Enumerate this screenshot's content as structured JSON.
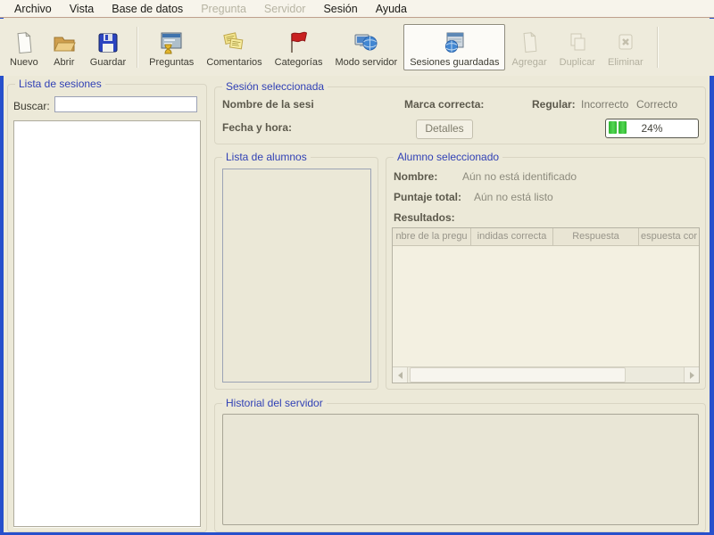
{
  "menubar": {
    "items": [
      {
        "label": "Archivo",
        "enabled": true
      },
      {
        "label": "Vista",
        "enabled": true
      },
      {
        "label": "Base de datos",
        "enabled": true
      },
      {
        "label": "Pregunta",
        "enabled": false
      },
      {
        "label": "Servidor",
        "enabled": false
      },
      {
        "label": "Sesión",
        "enabled": true
      },
      {
        "label": "Ayuda",
        "enabled": true
      }
    ]
  },
  "toolbar": {
    "overflow_chevron": "»",
    "buttons": [
      {
        "label": "Nuevo",
        "icon": "new-document-icon",
        "enabled": true,
        "selected": false
      },
      {
        "label": "Abrir",
        "icon": "open-folder-icon",
        "enabled": true,
        "selected": false
      },
      {
        "label": "Guardar",
        "icon": "save-floppy-icon",
        "enabled": true,
        "selected": false
      },
      {
        "label": "Preguntas",
        "icon": "questions-icon",
        "enabled": true,
        "selected": false
      },
      {
        "label": "Comentarios",
        "icon": "comments-notes-icon",
        "enabled": true,
        "selected": false
      },
      {
        "label": "Categorías",
        "icon": "categories-flag-icon",
        "enabled": true,
        "selected": false
      },
      {
        "label": "Modo servidor",
        "icon": "server-mode-icon",
        "enabled": true,
        "selected": false
      },
      {
        "label": "Sesiones guardadas",
        "icon": "saved-sessions-icon",
        "enabled": true,
        "selected": true
      },
      {
        "label": "Agregar",
        "icon": "add-icon",
        "enabled": false,
        "selected": false
      },
      {
        "label": "Duplicar",
        "icon": "duplicate-icon",
        "enabled": false,
        "selected": false
      },
      {
        "label": "Eliminar",
        "icon": "delete-icon",
        "enabled": false,
        "selected": false
      }
    ]
  },
  "sessions_panel": {
    "title": "Lista de sesiones",
    "search_label": "Buscar:",
    "search_value": "",
    "items": []
  },
  "selected_session_panel": {
    "title": "Sesión seleccionada",
    "name_label": "Nombre de la sesi",
    "mark_label": "Marca correcta:",
    "regular_label": "Regular:",
    "incorrect_label": "Incorrecto",
    "correct_label": "Correcto",
    "date_label": "Fecha y hora:",
    "details_button": "Detalles",
    "progress_text": "24%",
    "progress_percent": 24
  },
  "students_panel": {
    "title": "Lista de alumnos",
    "items": []
  },
  "selected_student_panel": {
    "title": "Alumno seleccionado",
    "name_label": "Nombre:",
    "name_value": "Aún no está identificado",
    "score_label": "Puntaje total:",
    "score_value": "Aún no está listo",
    "results_label": "Resultados:",
    "results_table": {
      "columns": [
        "nbre de la pregu",
        "indidas correcta",
        "Respuesta",
        "espuesta cor"
      ],
      "rows": []
    }
  },
  "history_panel": {
    "title": "Historial del servidor",
    "content": ""
  },
  "colors": {
    "window_border": "#2750cc",
    "background": "#ece9d8",
    "group_title": "#3141b5",
    "progress_green": "#3fc43f",
    "selected_button_bg": "#fcfbf7",
    "menubar_bg": "#f7f4eb"
  }
}
